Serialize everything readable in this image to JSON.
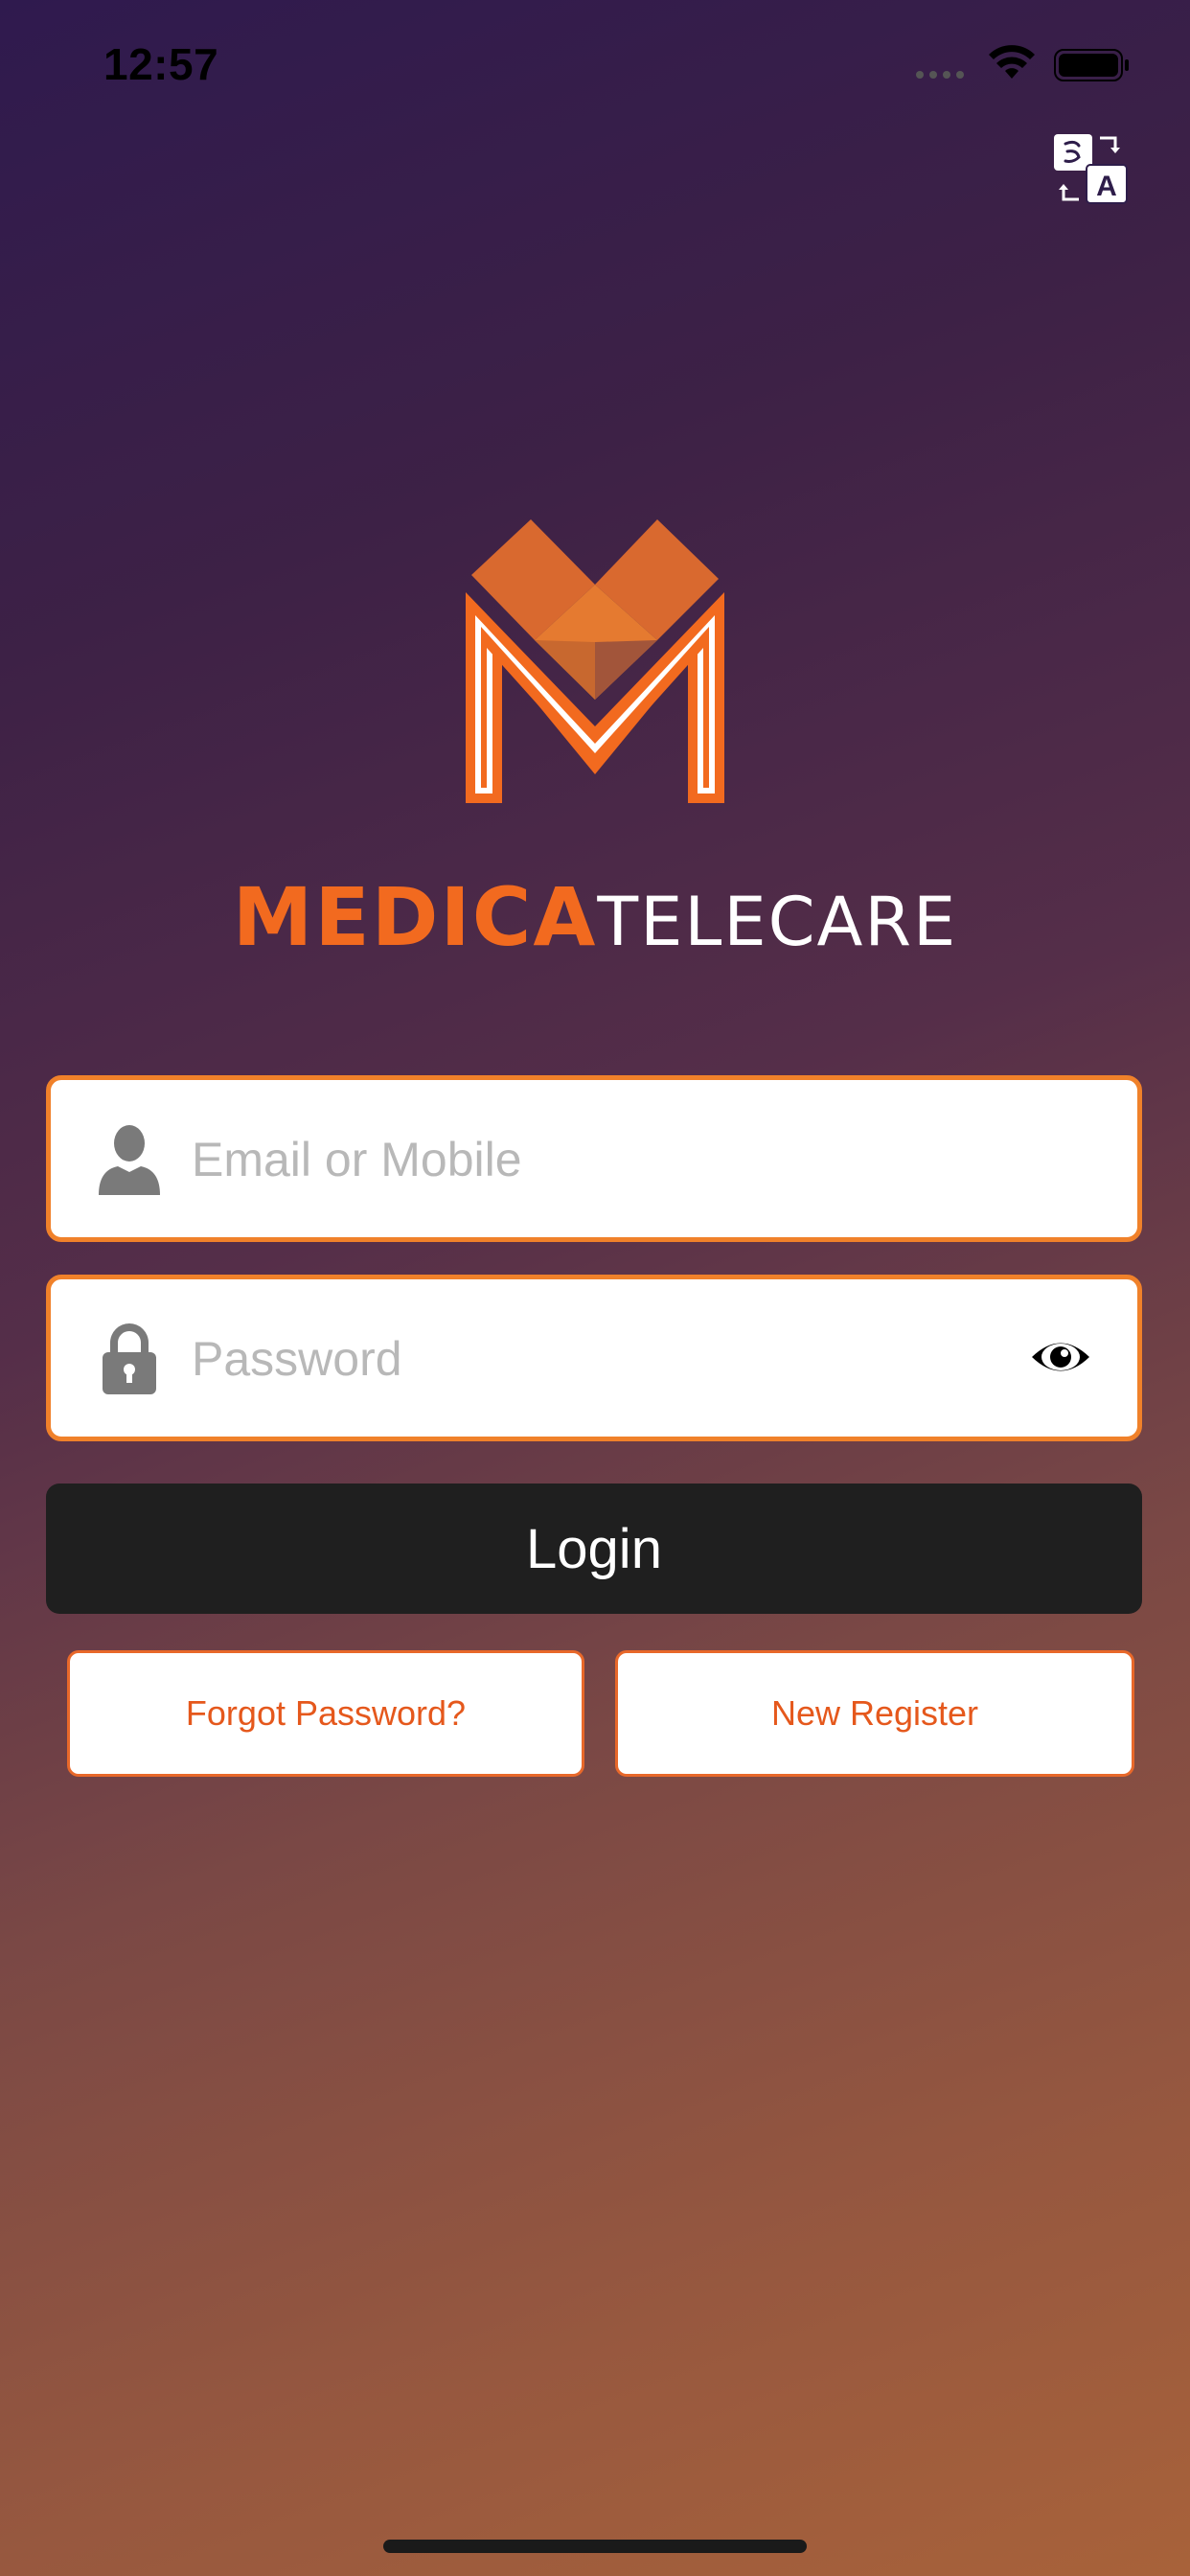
{
  "status_bar": {
    "time": "12:57"
  },
  "header": {
    "translate_icon": "translate-icon"
  },
  "brand": {
    "logo_icon": "medica-m-logo",
    "name_part_1": "MEDICA",
    "name_part_2": "TELECARE",
    "accent_color": "#f26a1f"
  },
  "login_form": {
    "email": {
      "icon": "user-icon",
      "placeholder": "Email or Mobile",
      "value": ""
    },
    "password": {
      "icon": "lock-icon",
      "placeholder": "Password",
      "value": "",
      "toggle_icon": "eye-icon"
    },
    "login_label": "Login",
    "forgot_label": "Forgot Password?",
    "register_label": "New Register"
  }
}
